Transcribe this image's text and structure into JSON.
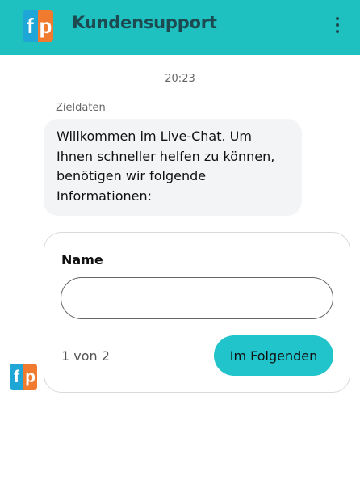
{
  "header": {
    "logo_f": "f",
    "logo_p": "p",
    "title": "Kundensupport",
    "menu_icon": "more-vertical-icon"
  },
  "chat": {
    "timestamp": "20:23",
    "sender": "Zieldaten",
    "welcome_message": "Willkommen im Live-Chat. Um Ihnen schneller helfen zu können, benötigen wir folgende Informationen:",
    "avatar_f": "f",
    "avatar_p": "p"
  },
  "form": {
    "field_label": "Name",
    "name_value": "",
    "step_text": "1 von 2",
    "next_label": "Im Folgenden"
  },
  "colors": {
    "header_bg": "#1fc0c0",
    "button_bg": "#22c4cc",
    "bubble_bg": "#f3f4f6",
    "logo_blue": "#1ea7d6",
    "logo_orange": "#f07b2e"
  }
}
